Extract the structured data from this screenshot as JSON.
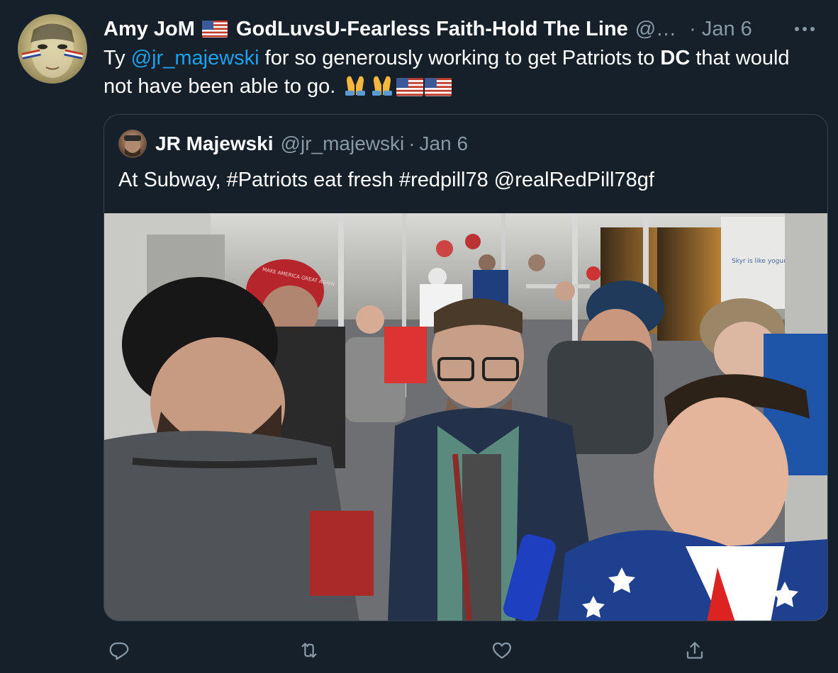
{
  "tweet": {
    "author": {
      "display_name_part1": "Amy JoM",
      "display_name_part2": "GodLuvsU-Fearless Faith-Hold The Line",
      "handle": "@…",
      "date_separator": "·",
      "date": "Jan 6"
    },
    "body": {
      "prefix": "Ty ",
      "mention": "@jr_majewski",
      "middle": " for so generously working to get Patriots to ",
      "bold": "DC",
      "suffix": " that would not have been able to go. "
    },
    "more_label": "•••"
  },
  "quoted_tweet": {
    "display_name": "JR Majewski",
    "handle": "@jr_majewski",
    "date_separator": "·",
    "date": "Jan 6",
    "text": "At Subway, #Patriots eat fresh #redpill78 @realRedPill78gf",
    "photo": {
      "hat_text": "MAKE AMERICA GREAT AGAIN",
      "poster_text": "Skyr is like yogurt but thicker, tastier, and Icelandier."
    }
  },
  "actions": [
    {
      "name": "reply-icon"
    },
    {
      "name": "retweet-icon"
    },
    {
      "name": "like-icon"
    },
    {
      "name": "share-icon"
    }
  ],
  "colors": {
    "background": "#15202b",
    "text": "#ffffff",
    "secondary": "#8899a6",
    "link": "#1da1f2",
    "border": "#38444d"
  }
}
